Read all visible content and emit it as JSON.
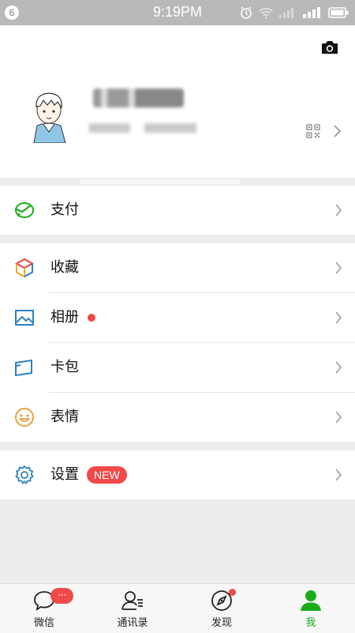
{
  "status_bar": {
    "notif_count": "6",
    "time": "9:19PM"
  },
  "profile": {
    "has_camera": true
  },
  "menu": {
    "pay": {
      "label": "支付",
      "icon": "wallet-icon",
      "color": "#1aad19"
    },
    "favorites": {
      "label": "收藏",
      "icon": "cube-icon"
    },
    "album": {
      "label": "相册",
      "icon": "image-icon",
      "color": "#2c80c5"
    },
    "cards": {
      "label": "卡包",
      "icon": "card-icon",
      "color": "#2c80c5"
    },
    "stickers": {
      "label": "表情",
      "icon": "smiley-icon",
      "color": "#e6a23c"
    },
    "settings": {
      "label": "设置",
      "badge": "NEW",
      "icon": "gear-icon",
      "color": "#2c80c5"
    }
  },
  "tabbar": {
    "chats": {
      "label": "微信",
      "badge": "···"
    },
    "contacts": {
      "label": "通讯录"
    },
    "discover": {
      "label": "发现"
    },
    "me": {
      "label": "我",
      "active_color": "#1aad19"
    }
  }
}
